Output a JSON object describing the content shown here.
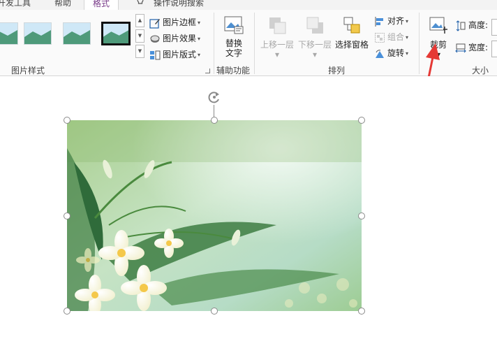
{
  "tabs": [
    {
      "label": "开发工具",
      "active": false
    },
    {
      "label": "帮助",
      "active": false
    },
    {
      "label": "格式",
      "active": true
    },
    {
      "label": "操作说明搜索",
      "active": false
    }
  ],
  "picture_styles": {
    "group_label": "图片样式",
    "border_label": "图片边框",
    "effects_label": "图片效果",
    "layout_label": "图片版式"
  },
  "accessibility": {
    "group_label": "辅助功能",
    "alt_text_line1": "替换",
    "alt_text_line2": "文字"
  },
  "arrange": {
    "group_label": "排列",
    "bring_forward": "上移一层",
    "send_backward": "下移一层",
    "selection_pane": "选择窗格",
    "align": "对齐",
    "group": "组合",
    "rotate": "旋转"
  },
  "size": {
    "group_label": "大小",
    "crop": "裁剪",
    "height_label": "高度:",
    "width_label": "宽度:"
  },
  "colors": {
    "accent": "#7a3c8a",
    "arrow": "#e53935"
  }
}
